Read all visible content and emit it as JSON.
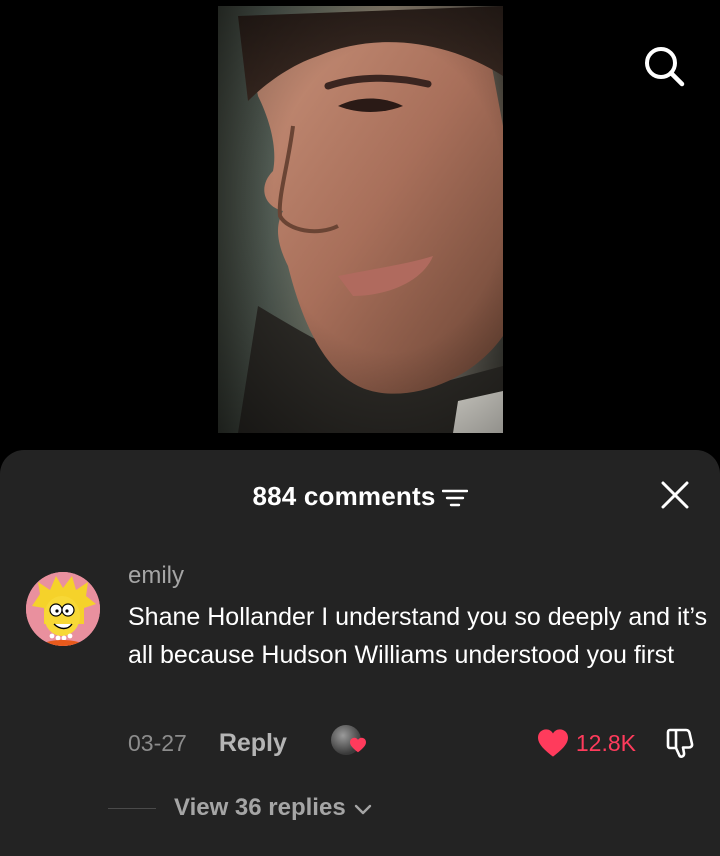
{
  "video": {
    "description_icon": "video-frame"
  },
  "top_bar": {
    "search_icon": "search-icon"
  },
  "comments_sheet": {
    "title": "884 comments",
    "filter_icon": "sort-filter-icon",
    "close_icon": "close-icon"
  },
  "comment": {
    "username": "emily",
    "text": "Shane Hollander I understand you so deeply and it’s all because Hudson Williams understood you first",
    "date": "03-27",
    "reply_label": "Reply",
    "likes": "12.8K",
    "liked": true,
    "creator_liked": true,
    "view_replies": "View 36 replies"
  },
  "colors": {
    "sheet_bg": "#232323",
    "like_red": "#ff3b5c",
    "muted_text": "#a5a5a5"
  }
}
